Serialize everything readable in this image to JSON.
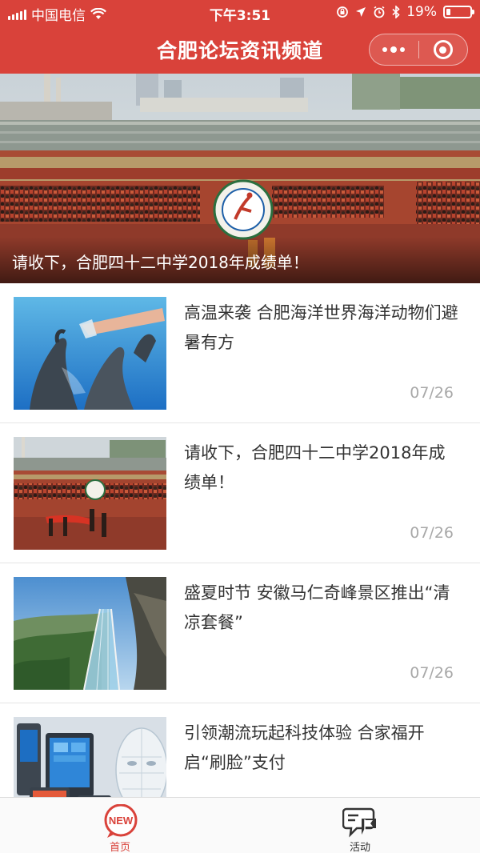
{
  "status_bar": {
    "carrier": "中国电信",
    "time": "下午3:51",
    "battery": "19%",
    "battery_level": 0.19
  },
  "nav": {
    "title": "合肥论坛资讯频道",
    "menu_icon": "more-dots-icon",
    "close_icon": "target-close-icon"
  },
  "banner": {
    "caption": "请收下，合肥四十二中学2018年成绩单！"
  },
  "articles": [
    {
      "title": "高温来袭 合肥海洋世界海洋动物们避暑有方",
      "date": "07/26"
    },
    {
      "title": "请收下，合肥四十二中学2018年成绩单！",
      "date": "07/26"
    },
    {
      "title": "盛夏时节 安徽马仁奇峰景区推出“清凉套餐”",
      "date": "07/26"
    },
    {
      "title": "引领潮流玩起科技体验 合家福开启“刷脸”支付",
      "date": ""
    }
  ],
  "tabbar": {
    "tabs": [
      {
        "label": "首页",
        "icon": "new-badge-icon",
        "active": true
      },
      {
        "label": "活动",
        "icon": "chat-flag-icon",
        "active": false
      }
    ],
    "badge_text": "NEW"
  },
  "colors": {
    "brand": "#d9423a",
    "text": "#333333",
    "muted": "#a8a8a8",
    "tab_inactive": "#333333"
  }
}
